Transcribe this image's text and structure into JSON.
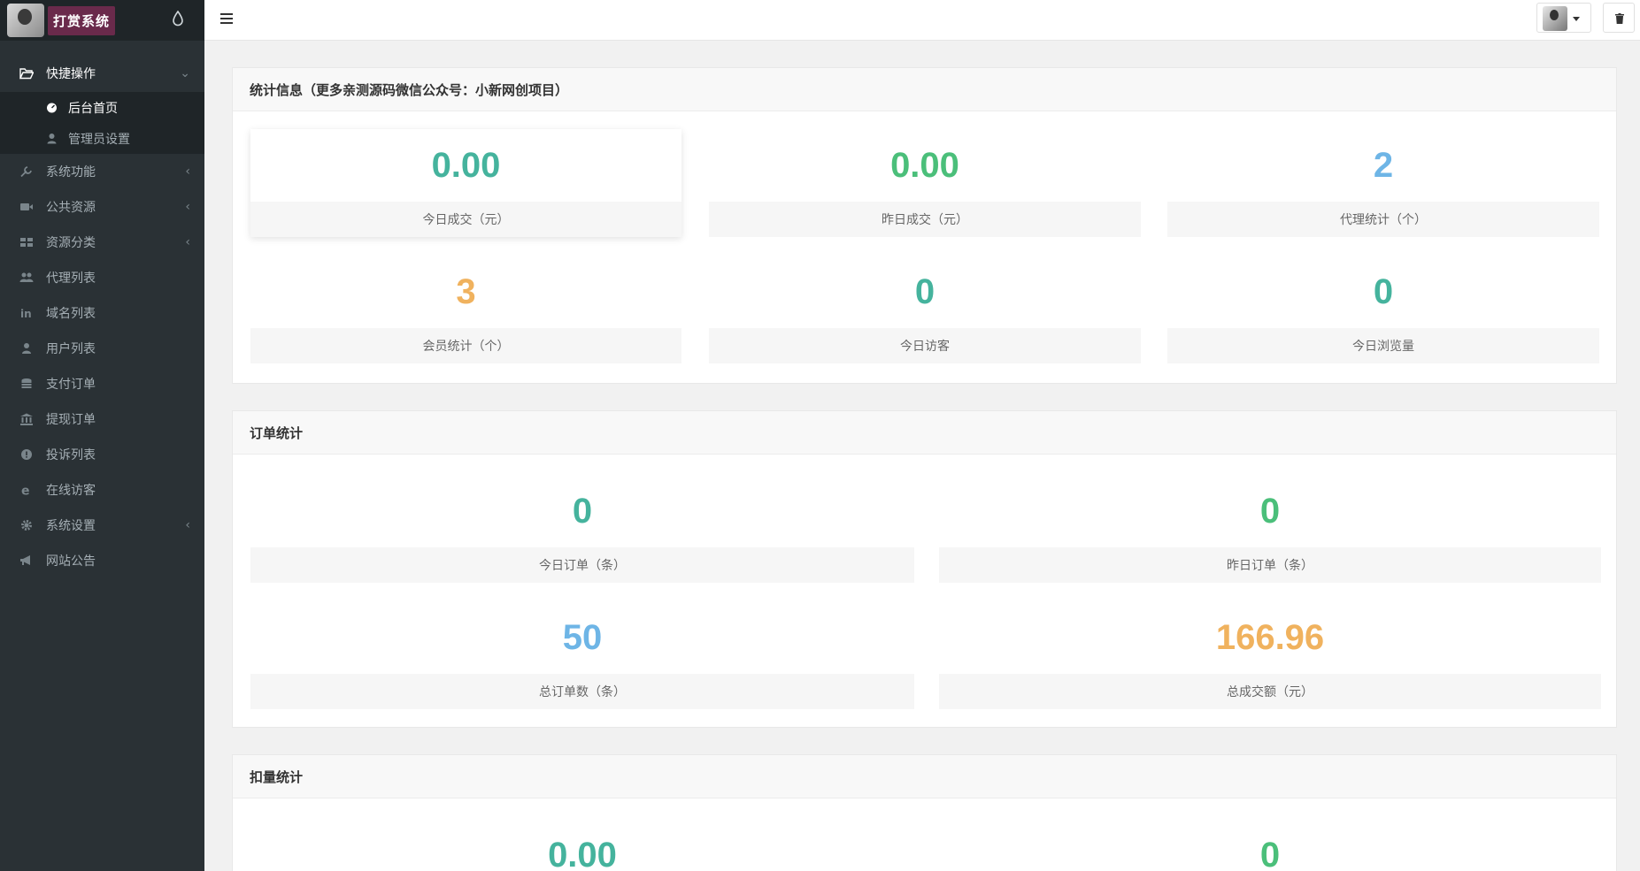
{
  "brand": {
    "title": "打赏系统"
  },
  "sidebar": {
    "items": [
      {
        "label": "快捷操作",
        "icon": "folder-open-icon",
        "expanded": true,
        "children": [
          {
            "label": "后台首页",
            "icon": "dashboard-icon",
            "active": true
          },
          {
            "label": "管理员设置",
            "icon": "user-icon"
          }
        ]
      },
      {
        "label": "系统功能",
        "icon": "wrench-icon",
        "has_children": true
      },
      {
        "label": "公共资源",
        "icon": "video-camera-icon",
        "has_children": true
      },
      {
        "label": "资源分类",
        "icon": "grid-icon",
        "has_children": true
      },
      {
        "label": "代理列表",
        "icon": "users-icon"
      },
      {
        "label": "域名列表",
        "icon": "linkedin-icon"
      },
      {
        "label": "用户列表",
        "icon": "user-icon"
      },
      {
        "label": "支付订单",
        "icon": "database-icon"
      },
      {
        "label": "提现订单",
        "icon": "bank-icon"
      },
      {
        "label": "投诉列表",
        "icon": "alert-circle-icon"
      },
      {
        "label": "在线访客",
        "icon": "ie-icon"
      },
      {
        "label": "系统设置",
        "icon": "gear-icon",
        "has_children": true
      },
      {
        "label": "网站公告",
        "icon": "bullhorn-icon"
      }
    ]
  },
  "panels": [
    {
      "title": "统计信息（更多亲测源码微信公众号：小新网创项目）",
      "stats": [
        {
          "value": "0.00",
          "label": "今日成交（元）",
          "color": "#45b39d"
        },
        {
          "value": "0.00",
          "label": "昨日成交（元）",
          "color": "#4bbf7a"
        },
        {
          "value": "2",
          "label": "代理统计（个）",
          "color": "#6eb5e6"
        },
        {
          "value": "3",
          "label": "会员统计（个）",
          "color": "#f0b25e"
        },
        {
          "value": "0",
          "label": "今日访客",
          "color": "#45b39d"
        },
        {
          "value": "0",
          "label": "今日浏览量",
          "color": "#45b39d"
        }
      ]
    },
    {
      "title": "订单统计",
      "stats": [
        {
          "value": "0",
          "label": "今日订单（条）",
          "color": "#45b39d"
        },
        {
          "value": "0",
          "label": "昨日订单（条）",
          "color": "#4bbf7a"
        },
        {
          "value": "50",
          "label": "总订单数（条）",
          "color": "#6eb5e6"
        },
        {
          "value": "166.96",
          "label": "总成交额（元）",
          "color": "#f0b25e"
        }
      ]
    },
    {
      "title": "扣量统计",
      "stats": [
        {
          "value": "0.00",
          "color": "#45b39d"
        },
        {
          "value": "0",
          "color": "#4bbf7a"
        }
      ]
    }
  ]
}
